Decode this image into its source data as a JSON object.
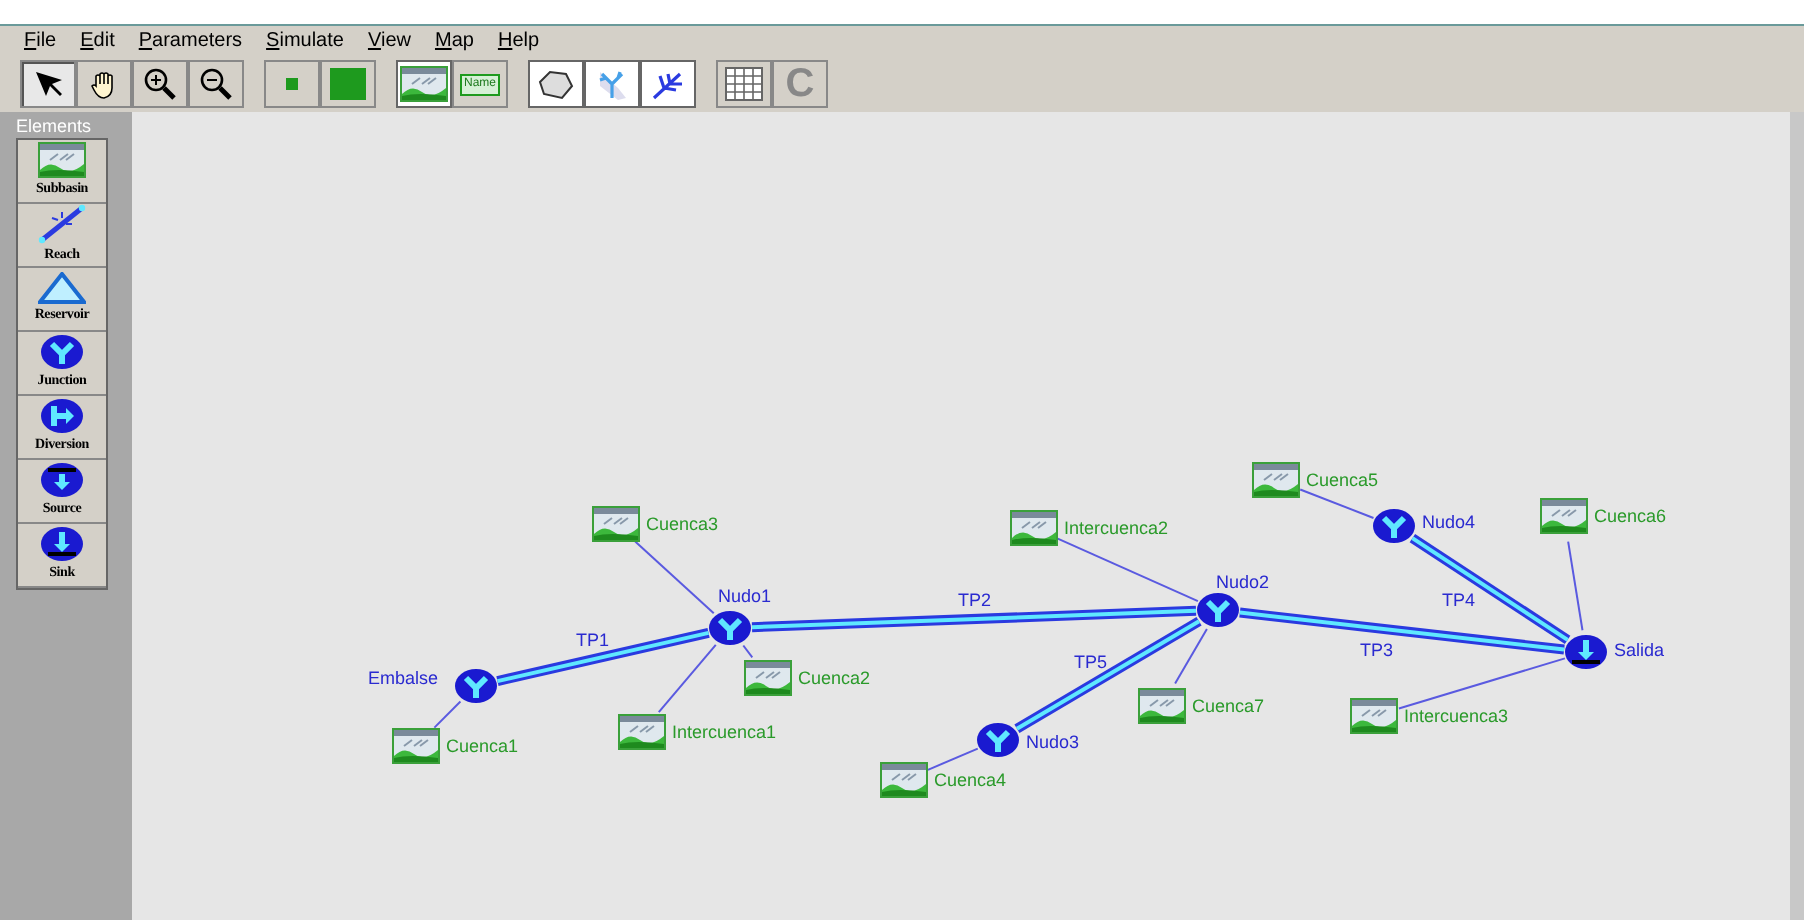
{
  "menu": [
    "File",
    "Edit",
    "Parameters",
    "Simulate",
    "View",
    "Map",
    "Help"
  ],
  "toolbar": [
    {
      "kind": "arrow",
      "pressed": true
    },
    {
      "kind": "hand",
      "pressed": false
    },
    {
      "kind": "zoom-in",
      "pressed": false
    },
    {
      "kind": "zoom-out",
      "pressed": false
    },
    {
      "kind": "small-square",
      "pressed": false
    },
    {
      "kind": "big-square",
      "pressed": false
    },
    {
      "kind": "picture",
      "pressed": true
    },
    {
      "kind": "name",
      "label": "Name",
      "pressed": false
    },
    {
      "kind": "outline",
      "pressed": true
    },
    {
      "kind": "tree",
      "pressed": true
    },
    {
      "kind": "branch",
      "pressed": true
    },
    {
      "kind": "grid",
      "pressed": false
    },
    {
      "kind": "clear",
      "label": "C",
      "pressed": false
    }
  ],
  "palette": {
    "title": "Elements",
    "items": [
      {
        "kind": "subbasin",
        "label": "Subbasin"
      },
      {
        "kind": "reach",
        "label": "Reach"
      },
      {
        "kind": "reservoir",
        "label": "Reservoir"
      },
      {
        "kind": "junction",
        "label": "Junction"
      },
      {
        "kind": "diversion",
        "label": "Diversion"
      },
      {
        "kind": "source",
        "label": "Source"
      },
      {
        "kind": "sink",
        "label": "Sink"
      }
    ]
  },
  "network": {
    "nodes": [
      {
        "kind": "junction",
        "label": "Embalse"
      },
      {
        "kind": "junction",
        "label": "Nudo1"
      },
      {
        "kind": "junction",
        "label": "Nudo2"
      },
      {
        "kind": "junction",
        "label": "Nudo3"
      },
      {
        "kind": "junction",
        "label": "Nudo4"
      },
      {
        "kind": "sink",
        "label": "Salida"
      }
    ],
    "subbasins": [
      {
        "label": "Cuenca3"
      },
      {
        "label": "Cuenca1"
      },
      {
        "label": "Cuenca2"
      },
      {
        "label": "Intercuenca1"
      },
      {
        "label": "Intercuenca2"
      },
      {
        "label": "Cuenca5"
      },
      {
        "label": "Cuenca6"
      },
      {
        "label": "Cuenca7"
      },
      {
        "label": "Cuenca4"
      },
      {
        "label": "Intercuenca3"
      }
    ],
    "reaches": [
      {
        "label": "TP1"
      },
      {
        "label": "TP2"
      },
      {
        "label": "TP5"
      },
      {
        "label": "TP3"
      },
      {
        "label": "TP4"
      }
    ]
  }
}
